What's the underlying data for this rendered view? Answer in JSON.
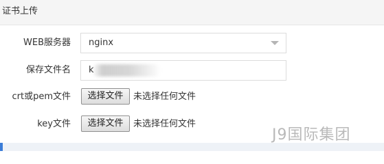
{
  "panel": {
    "title": "证书上传"
  },
  "form": {
    "web_server": {
      "label": "WEB服务器",
      "selected": "nginx"
    },
    "filename": {
      "label": "保存文件名",
      "value": "k"
    },
    "crt_file": {
      "label": "crt或pem文件",
      "button_label": "选择文件",
      "status": "未选择任何文件"
    },
    "key_file": {
      "label": "key文件",
      "button_label": "选择文件",
      "status": "未选择任何文件"
    }
  },
  "watermark": {
    "text": "J9国际集团"
  },
  "colors": {
    "header_bg": "#f5f5f5",
    "border": "#dcdcdc",
    "accent": "#3b7dd8"
  }
}
